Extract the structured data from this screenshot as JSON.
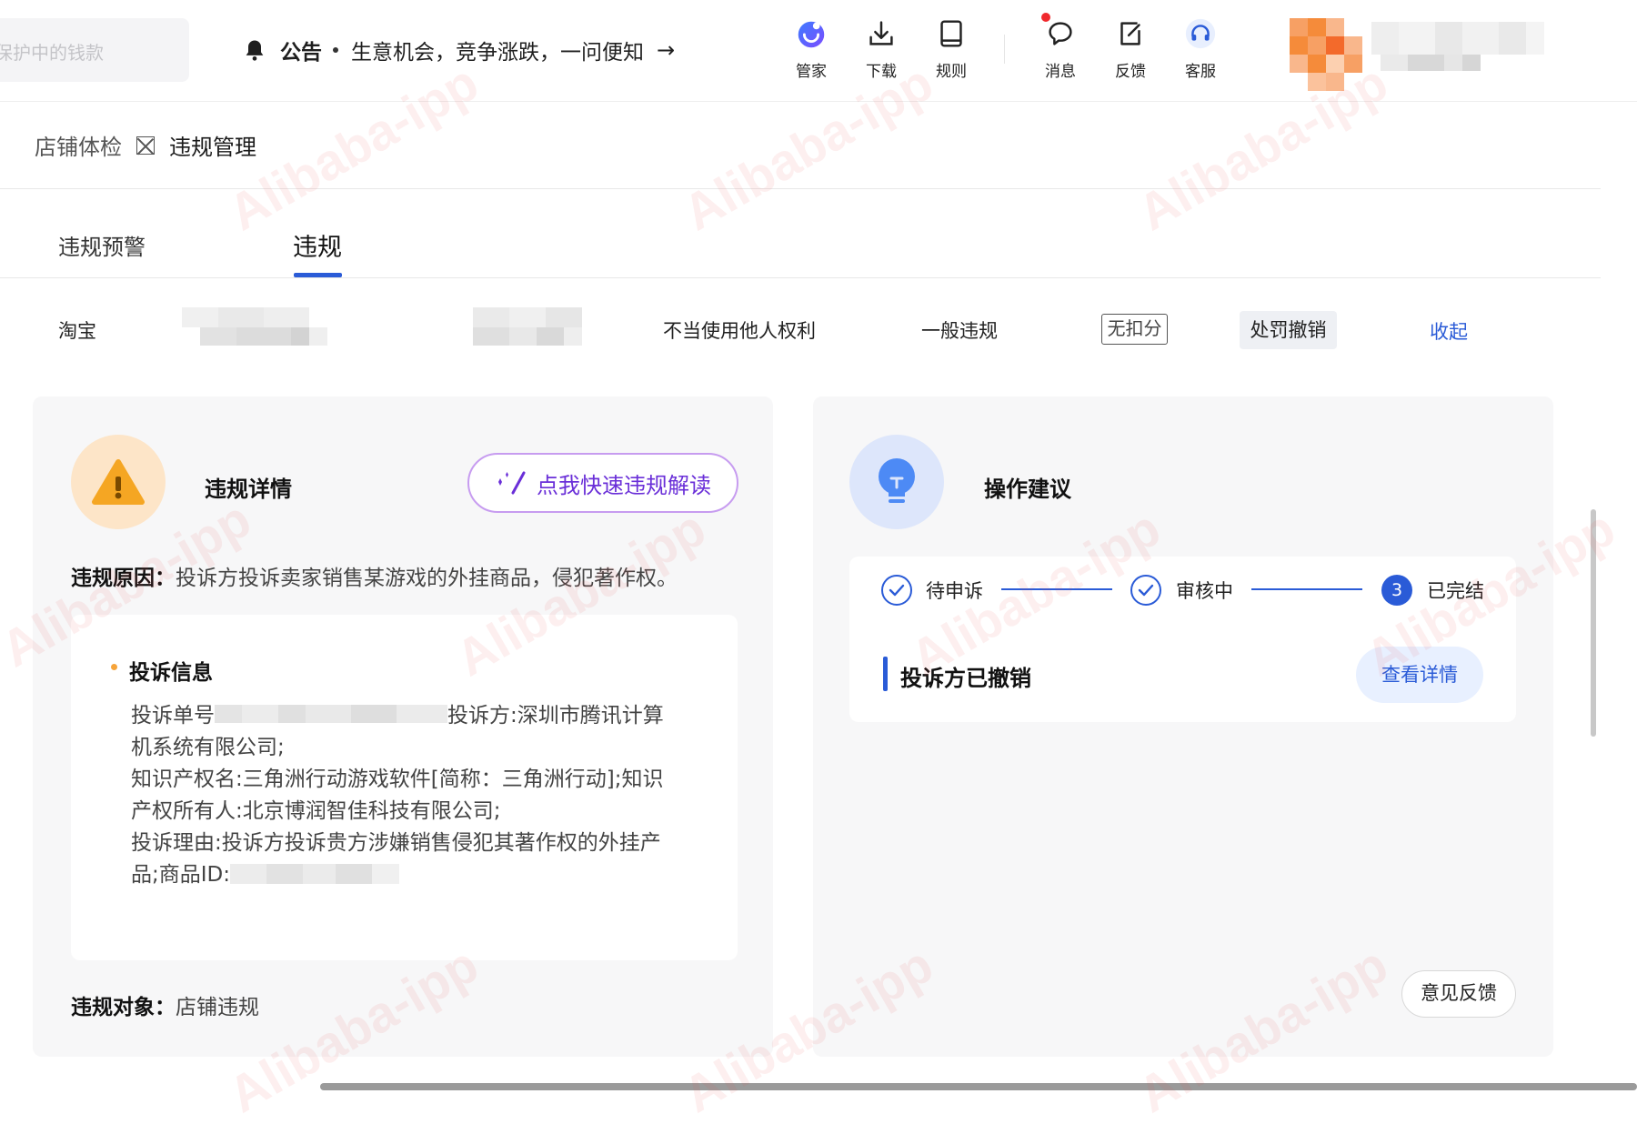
{
  "topbar": {
    "search_placeholder": "保护中的钱款",
    "notice": {
      "title": "公告",
      "text": "生意机会，竞争涨跌，一问便知",
      "arrow": "→"
    },
    "tools": [
      {
        "icon": "assistant-icon",
        "label": "管家"
      },
      {
        "icon": "download-icon",
        "label": "下载"
      },
      {
        "icon": "book-icon",
        "label": "规则"
      },
      {
        "icon": "message-icon",
        "label": "消息"
      },
      {
        "icon": "feedback-icon",
        "label": "反馈"
      },
      {
        "icon": "headset-icon",
        "label": "客服"
      }
    ],
    "accent_color": "#2a5bd7",
    "badge_color": "#f0292d"
  },
  "breadcrumb": {
    "items": [
      "店铺体检",
      "违规管理"
    ]
  },
  "tabs": [
    {
      "label": "违规预警",
      "active": false
    },
    {
      "label": "违规",
      "active": true
    }
  ],
  "record": {
    "platform": "淘宝",
    "violation_type": "不当使用他人权利",
    "level": "一般违规",
    "points": "无扣分",
    "status": "处罚撤销",
    "collapse_label": "收起"
  },
  "details": {
    "title": "违规详情",
    "ai_button_label": "点我快速违规解读",
    "reason_label": "违规原因：",
    "reason_text": "投诉方投诉卖家销售某游戏的外挂商品，侵犯著作权。",
    "complaint": {
      "title": "投诉信息",
      "lines": [
        {
          "prefix": "投诉单号",
          "suffix": "投诉方:深圳市腾讯计算"
        },
        {
          "text": "机系统有限公司;"
        },
        {
          "text": "知识产权名:三角洲行动游戏软件[简称：三角洲行动];知识"
        },
        {
          "text": "产权所有人:北京博润智佳科技有限公司;"
        },
        {
          "text": "投诉理由:投诉方投诉贵方涉嫌销售侵犯其著作权的外挂产"
        },
        {
          "prefix": "品;商品ID:"
        }
      ]
    },
    "object_label": "违规对象：",
    "object_value": "店铺违规"
  },
  "advice": {
    "title": "操作建议",
    "steps": [
      {
        "label": "待申诉",
        "state": "done"
      },
      {
        "label": "审核中",
        "state": "done"
      },
      {
        "label": "已完结",
        "state": "current",
        "number": "3"
      }
    ],
    "status_text": "投诉方已撤销",
    "detail_button": "查看详情"
  },
  "feedback_button": "意见反馈",
  "watermark_text": "Alibaba-ipp"
}
